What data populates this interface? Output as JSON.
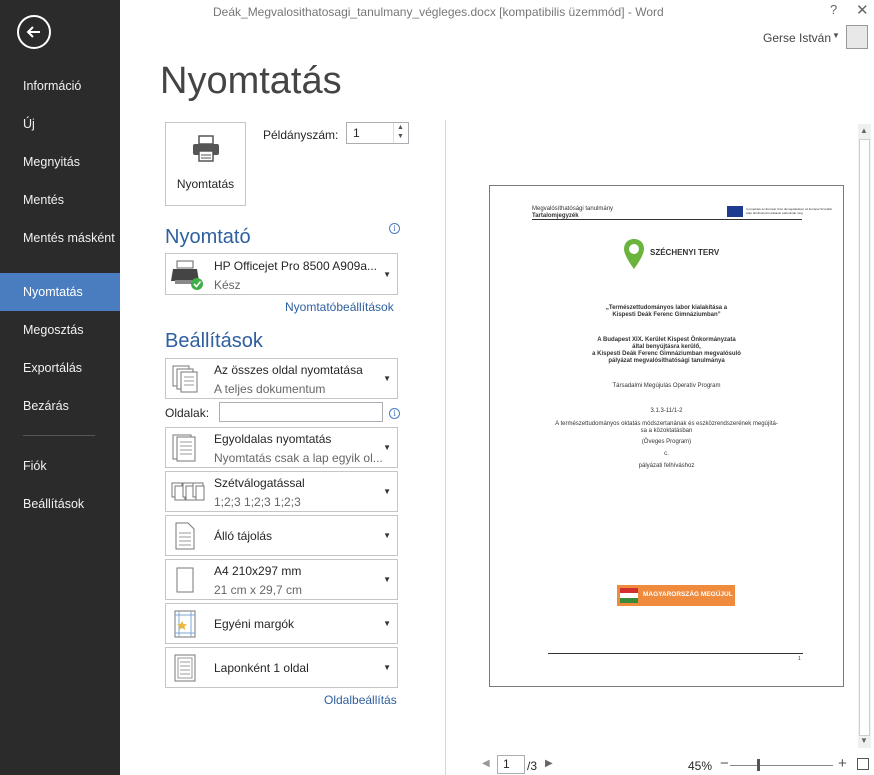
{
  "window": {
    "title": "Deák_Megvalosithatosagi_tanulmany_végleges.docx [kompatibilis üzemmód] - Word",
    "help": "?",
    "close": "✕",
    "user": "Gerse István"
  },
  "nav": {
    "items": [
      {
        "label": "Információ"
      },
      {
        "label": "Új"
      },
      {
        "label": "Megnyitás"
      },
      {
        "label": "Mentés"
      },
      {
        "label": "Mentés másként"
      },
      {
        "label": "Nyomtatás",
        "active": true
      },
      {
        "label": "Megosztás"
      },
      {
        "label": "Exportálás"
      },
      {
        "label": "Bezárás"
      },
      {
        "label": "Fiók"
      },
      {
        "label": "Beállítások"
      }
    ]
  },
  "page_title": "Nyomtatás",
  "print": {
    "button_label": "Nyomtatás",
    "copies_label": "Példányszám:",
    "copies_value": "1"
  },
  "printer": {
    "heading": "Nyomtató",
    "name": "HP Officejet Pro 8500 A909a...",
    "status": "Kész",
    "properties_link": "Nyomtatóbeállítások"
  },
  "settings": {
    "heading": "Beállítások",
    "pages_label": "Oldalak:",
    "pages_value": "",
    "range": {
      "l1": "Az összes oldal nyomtatása",
      "l2": "A teljes dokumentum"
    },
    "sides": {
      "l1": "Egyoldalas nyomtatás",
      "l2": "Nyomtatás csak a lap egyik ol..."
    },
    "collate": {
      "l1": "Szétválogatással",
      "l2": "1;2;3    1;2;3    1;2;3"
    },
    "orientation": {
      "l1": "Álló tájolás"
    },
    "paper": {
      "l1": "A4 210x297 mm",
      "l2": "21 cm x 29,7 cm"
    },
    "margins": {
      "l1": "Egyéni margók"
    },
    "per_sheet": {
      "l1": "Laponként 1 oldal"
    },
    "page_setup_link": "Oldalbeállítás"
  },
  "preview": {
    "header_l1": "Megvalósíthatósági tanulmány",
    "header_l2": "Tartalomjegyzék",
    "eu_note": "A projektek az Európai Unió támogatásával, az Európai Szociális Alap társfinanszírozásával valósulnak meg",
    "szechenyi": "SZÉCHENYI TERV",
    "title_1": "„Természettudományos labor kialakítása a",
    "title_2": "Kispesti Deák Ferenc Gimnáziumban”",
    "sub_1": "A Budapest XIX. Kerület Kispest Önkormányzata",
    "sub_2": "által benyújtásra kerülő,",
    "sub_3": "a Kispesti Deák Ferenc Gimnáziumban megvalósuló",
    "sub_4": "pályázat megvalósíthatósági tanulmánya",
    "program": "Társadalmi Megújulás Operatív Program",
    "code": "3.1.3-11/1-2",
    "desc_1": "A természettudományos oktatás módszertanának és eszközrendszerének megújítá-",
    "desc_2": "sa a közoktatásban",
    "desc_3": "(Öveges Program)",
    "desc_4": "c.",
    "desc_5": "pályázati felhíváshoz",
    "banner": "MAGYARORSZÁG MEGÚJUL",
    "page_num": "1"
  },
  "pager": {
    "current": "1",
    "total": "/3"
  },
  "zoom": {
    "label": "45%",
    "minus": "−",
    "plus": "+",
    "level_percent": 45
  }
}
